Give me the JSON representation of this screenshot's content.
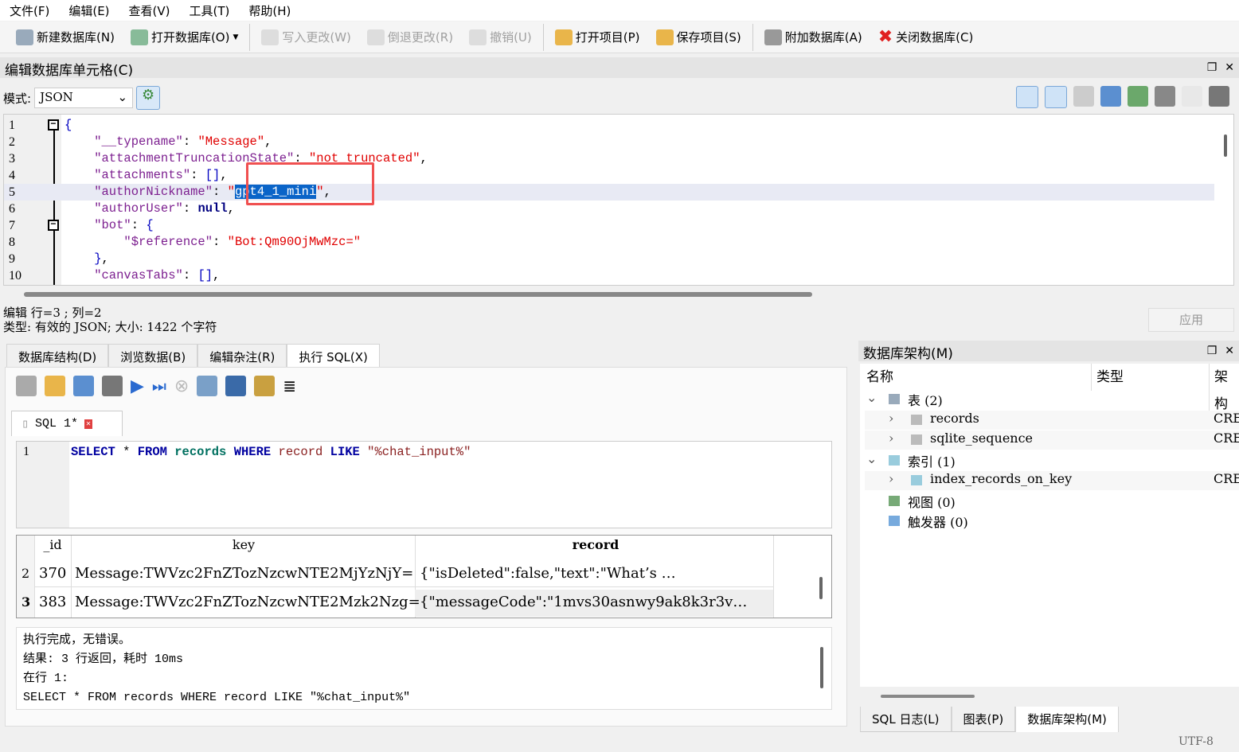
{
  "menu": [
    "文件(F)",
    "编辑(E)",
    "查看(V)",
    "工具(T)",
    "帮助(H)"
  ],
  "toolbar": {
    "new_db": "新建数据库(N)",
    "open_db": "打开数据库(O)",
    "write": "写入更改(W)",
    "revert": "倒退更改(R)",
    "undo": "撤销(U)",
    "open_project": "打开项目(P)",
    "save_project": "保存项目(S)",
    "attach": "附加数据库(A)",
    "close_db": "关闭数据库(C)"
  },
  "edit_cell": {
    "title": "编辑数据库单元格(C)",
    "mode_label": "模式:",
    "mode_value": "JSON",
    "lines": [
      {
        "n": "1",
        "tokens": [
          [
            "p",
            "{"
          ]
        ]
      },
      {
        "n": "2",
        "tokens": [
          [
            "k",
            "    \"__typename\""
          ],
          [
            "",
            ": "
          ],
          [
            "s",
            "\"Message\""
          ],
          [
            "",
            ","
          ]
        ]
      },
      {
        "n": "3",
        "tokens": [
          [
            "k",
            "    \"attachmentTruncationState\""
          ],
          [
            "",
            ": "
          ],
          [
            "s",
            "\"not_truncated\""
          ],
          [
            "",
            ","
          ]
        ]
      },
      {
        "n": "4",
        "tokens": [
          [
            "k",
            "    \"attachments\""
          ],
          [
            "",
            ": "
          ],
          [
            "p",
            "[]"
          ],
          [
            "",
            ","
          ]
        ]
      },
      {
        "n": "5",
        "tokens": [
          [
            "k",
            "    \"authorNickname\""
          ],
          [
            "",
            ": "
          ],
          [
            "s",
            "\""
          ],
          [
            "sel",
            "gpt4_1_mini"
          ],
          [
            "s",
            "\""
          ],
          [
            "",
            ","
          ]
        ]
      },
      {
        "n": "6",
        "tokens": [
          [
            "k",
            "    \"authorUser\""
          ],
          [
            "",
            ": "
          ],
          [
            "b",
            "null"
          ],
          [
            "",
            ","
          ]
        ]
      },
      {
        "n": "7",
        "tokens": [
          [
            "k",
            "    \"bot\""
          ],
          [
            "",
            ": "
          ],
          [
            "p",
            "{"
          ]
        ]
      },
      {
        "n": "8",
        "tokens": [
          [
            "k",
            "        \"$reference\""
          ],
          [
            "",
            ": "
          ],
          [
            "s",
            "\"Bot:Qm90OjMwMzc=\""
          ]
        ]
      },
      {
        "n": "9",
        "tokens": [
          [
            "p",
            "    }"
          ],
          [
            "",
            ","
          ]
        ]
      },
      {
        "n": "10",
        "tokens": [
          [
            "k",
            "    \"canvasTabs\""
          ],
          [
            "",
            ": "
          ],
          [
            "p",
            "[]"
          ],
          [
            "",
            ","
          ]
        ]
      }
    ],
    "status1": "编辑  行=3 ; 列=2",
    "status2": "类型: 有效的 JSON; 大小: 1422 个字符",
    "apply": "应用"
  },
  "tabs": [
    "数据库结构(D)",
    "浏览数据(B)",
    "编辑杂注(R)",
    "执行 SQL(X)"
  ],
  "sql": {
    "tab": "SQL 1*",
    "line_no": "1",
    "query": [
      [
        "kw",
        "SELECT"
      ],
      [
        "",
        " * "
      ],
      [
        "kw",
        "FROM"
      ],
      [
        "",
        " "
      ],
      [
        "tb2",
        "records"
      ],
      [
        "",
        " "
      ],
      [
        "kw",
        "WHERE"
      ],
      [
        "",
        " "
      ],
      [
        "str",
        "record"
      ],
      [
        "",
        " "
      ],
      [
        "kw",
        "LIKE"
      ],
      [
        "",
        " "
      ],
      [
        "str",
        "\"%chat_input%\""
      ]
    ],
    "columns": [
      "_id",
      "key",
      "record"
    ],
    "rows": [
      {
        "rn": "2",
        "id": "370",
        "key": "Message:TWVzc2FnZTozNzcwNTE2MjYzNjY=",
        "record": "{\"isDeleted\":false,\"text\":\"What’s …"
      },
      {
        "rn": "3",
        "id": "383",
        "key": "Message:TWVzc2FnZTozNzcwNTE2Mzk2Nzg=",
        "record": "{\"messageCode\":\"1mvs30asnwy9ak8k3r3v…"
      }
    ],
    "messages": [
      "执行完成，无错误。",
      "结果: 3 行返回，耗时 10ms",
      "在行 1:",
      "SELECT * FROM records WHERE record LIKE \"%chat_input%\""
    ]
  },
  "schema": {
    "title": "数据库架构(M)",
    "cols": [
      "名称",
      "类型",
      "架构"
    ],
    "items": [
      {
        "label": "表 (2)",
        "type": ""
      },
      {
        "label": "records",
        "type": "CRE"
      },
      {
        "label": "sqlite_sequence",
        "type": "CRE"
      },
      {
        "label": "索引 (1)",
        "type": ""
      },
      {
        "label": "index_records_on_key",
        "type": "CRE"
      },
      {
        "label": "视图 (0)",
        "type": ""
      },
      {
        "label": "触发器 (0)",
        "type": ""
      }
    ]
  },
  "bottom_tabs": [
    "SQL 日志(L)",
    "图表(P)",
    "数据库架构(M)"
  ],
  "encoding": "UTF-8"
}
